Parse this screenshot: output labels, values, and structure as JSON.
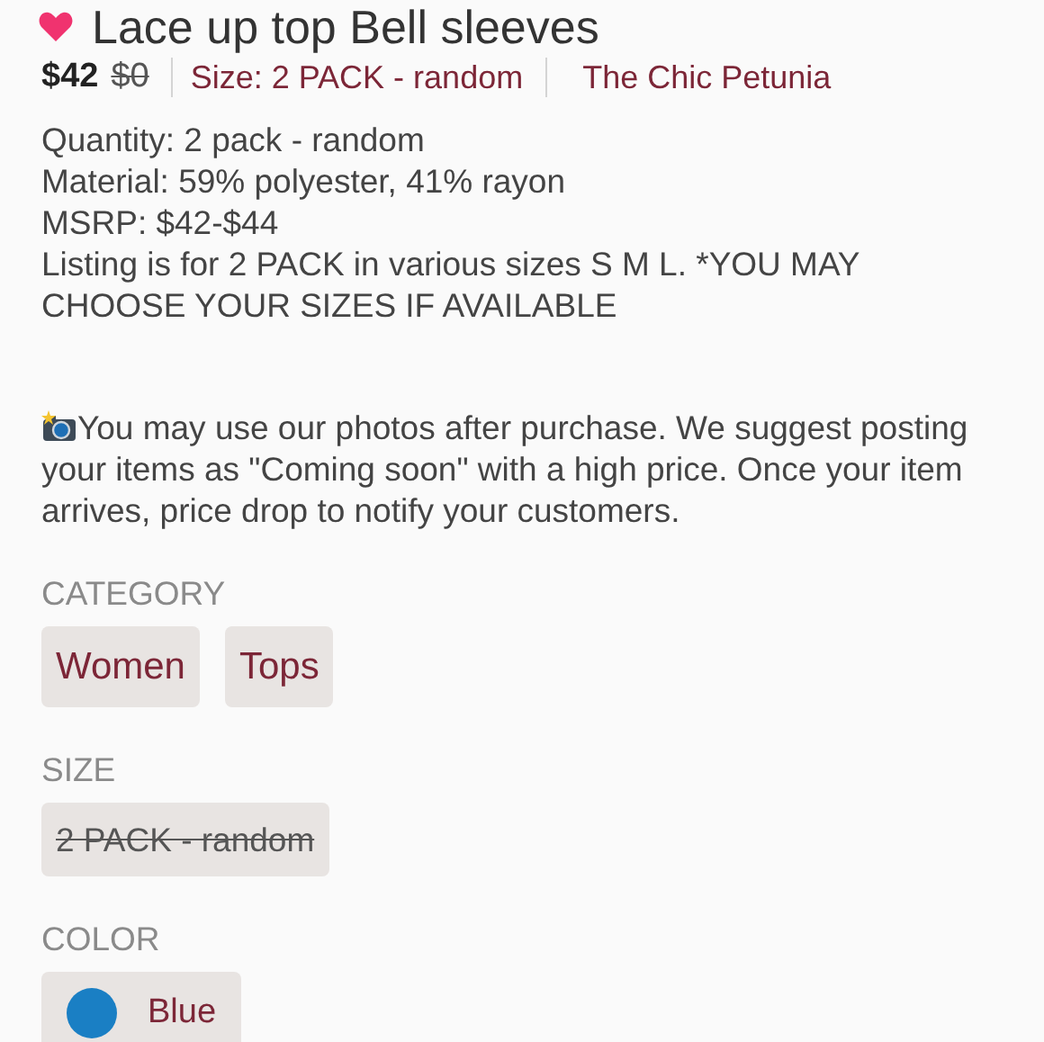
{
  "title": "Lace up top Bell sleeves",
  "price": "$42",
  "original_price": "$0",
  "size_link": "Size: 2 PACK - random",
  "seller_link": "The Chic Petunia",
  "details": [
    "Quantity:  2 pack - random",
    "Material:  59% polyester, 41% rayon",
    "MSRP:  $42-$44",
    " Listing is for 2 PACK in various sizes S M L.  *YOU MAY CHOOSE YOUR SIZES IF AVAILABLE"
  ],
  "note": "You may use our photos after purchase. We suggest posting your items as \"Coming soon\" with a high price.  Once your item arrives, price drop to notify your customers.",
  "category": {
    "heading": "CATEGORY",
    "tags": [
      "Women",
      "Tops"
    ]
  },
  "size": {
    "heading": "SIZE",
    "options": [
      {
        "label": "2 PACK - random",
        "available": false
      }
    ]
  },
  "color": {
    "heading": "COLOR",
    "options": [
      {
        "label": "Blue",
        "color": "#1a7fc4"
      }
    ]
  }
}
